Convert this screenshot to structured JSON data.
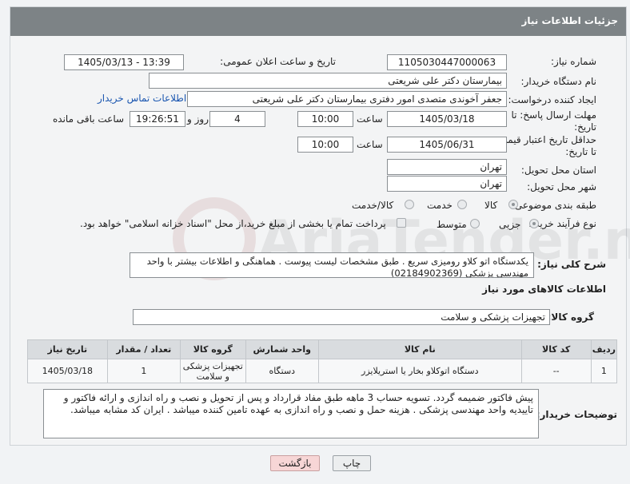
{
  "header": {
    "title": "جزئیات اطلاعات نیاز"
  },
  "form": {
    "need_number_label": "شماره نیاز:",
    "need_number": "1105030447000063",
    "announce_label": "تاریخ و ساعت اعلان عمومی:",
    "announce_value": "1405/03/13 - 13:39",
    "buyer_org_label": "نام دستگاه خریدار:",
    "buyer_org": "بیمارستان دکتر علی شریعتی",
    "creator_label": "ایجاد کننده درخواست:",
    "creator": "جعفر آخوندی متصدی امور دفتری بیمارستان دکتر علی شریعتی",
    "contact_link": "اطلاعات تماس خریدار",
    "deadline_label_1": "مهلت ارسال پاسخ: تا",
    "deadline_label_2": "تاریخ:",
    "deadline_date": "1405/03/18",
    "time_label": "ساعت",
    "deadline_time": "10:00",
    "days": "4",
    "days_label": "روز و",
    "remaining_time": "19:26:51",
    "remaining_label": "ساعت باقی مانده",
    "validity_label_1": "حداقل تاریخ اعتبار قیمت:",
    "validity_label_2": "تا تاریخ:",
    "validity_date": "1405/06/31",
    "validity_time": "10:00",
    "province_label": "استان محل تحویل:",
    "province": "تهران",
    "city_label": "شهر محل تحویل:",
    "city": "تهران",
    "category_label": "طبقه بندی موضوعی:",
    "category_options": [
      "کالا",
      "خدمت",
      "کالا/خدمت"
    ],
    "category_selected": 0,
    "process_label": "نوع فرآیند خرید :",
    "process_options": [
      "جزیی",
      "متوسط"
    ],
    "process_selected": 0,
    "payment_note": "پرداخت تمام یا بخشی از مبلغ خرید،از محل \"اسناد خزانه اسلامی\" خواهد بود.",
    "description_label": "شرح کلی نیاز:",
    "description": "یکدستگاه اتو کلاو رومیزی سریع . طبق مشخصات لیست پیوست . هماهنگی و اطلاعات بیشتر با واحد مهندسی پزشکی (02184902369)",
    "goods_info_title": "اطلاعات کالاهای مورد نیاز",
    "goods_group_label": "گروه کالا:",
    "goods_group": "تجهیزات پزشکی و سلامت"
  },
  "table": {
    "headers": [
      "ردیف",
      "کد کالا",
      "نام کالا",
      "واحد شمارش",
      "گروه کالا",
      "تعداد / مقدار",
      "تاریخ نیاز"
    ],
    "rows": [
      [
        "1",
        "--",
        "دستگاه اتوکلاو بخار یا استریلایزر",
        "دستگاه",
        "تجهیزات پزشکی و سلامت",
        "1",
        "1405/03/18"
      ]
    ]
  },
  "buyer_notes_label": "توضیحات خریدار:",
  "buyer_notes": "پیش فاکتور ضمیمه گردد. تسویه حساب 3 ماهه طبق مفاد قرارداد و پس از تحویل و نصب و راه اندازی و ارائه فاکتور و تاییدیه واحد مهندسی پزشکی . هزینه حمل و نصب و راه اندازی به عهده تامین کننده میباشد . ایران کد مشابه میباشد.",
  "buttons": {
    "print": "چاپ",
    "back": "بازگشت"
  },
  "watermark": "AriaTender.neT",
  "colors": {
    "header_bg": "#7d8386",
    "link": "#1a56b0",
    "back_button_bg": "#f7d6d6"
  }
}
